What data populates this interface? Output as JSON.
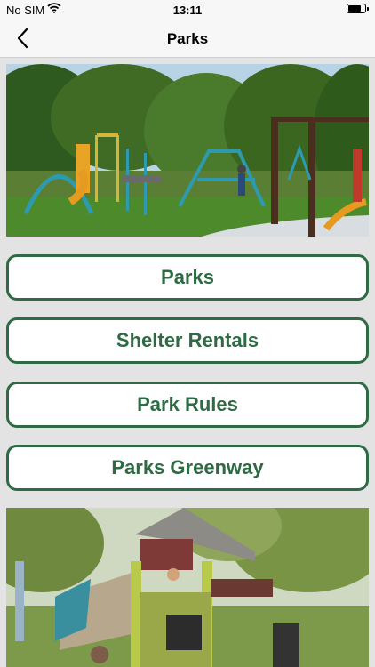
{
  "status_bar": {
    "carrier": "No SIM",
    "time": "13:11",
    "battery_level": 0.75
  },
  "nav": {
    "title": "Parks"
  },
  "menu": [
    {
      "label": "Parks"
    },
    {
      "label": "Shelter Rentals"
    },
    {
      "label": "Park Rules"
    },
    {
      "label": "Parks Greenway"
    }
  ],
  "theme": {
    "accent": "#2e6b45",
    "background": "#e3e3e3",
    "bar": "#f7f7f7"
  }
}
